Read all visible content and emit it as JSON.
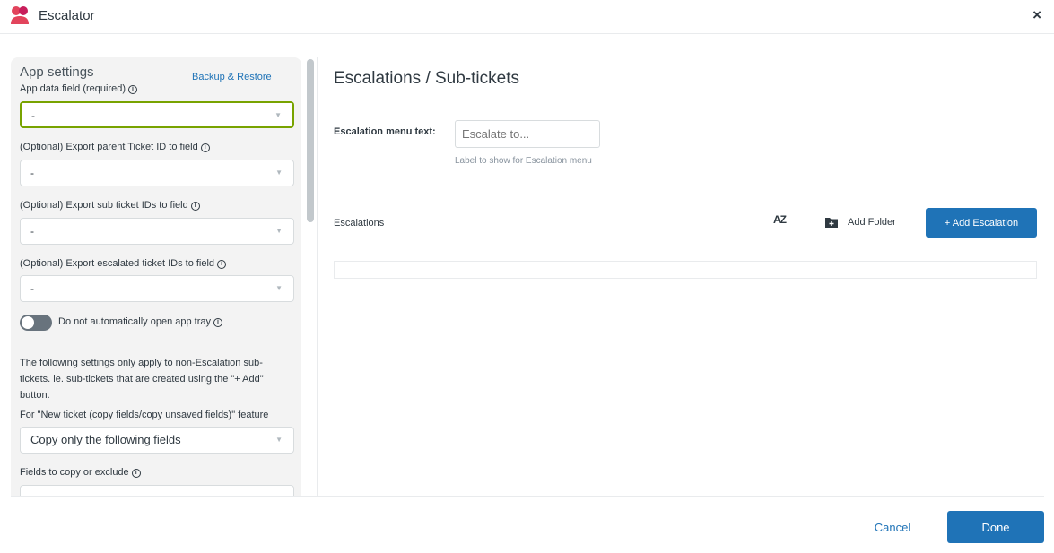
{
  "window": {
    "title": "Escalator",
    "close_label": "×"
  },
  "app_settings": {
    "heading": "App settings",
    "backup_link": "Backup & Restore",
    "app_data_field": {
      "label": "App data field (required)",
      "value": "-"
    },
    "export_parent": {
      "label": "(Optional) Export parent Ticket ID to field",
      "value": "-"
    },
    "export_sub": {
      "label": "(Optional) Export sub ticket IDs to field",
      "value": "-"
    },
    "export_escalated": {
      "label": "(Optional) Export escalated ticket IDs to field",
      "value": "-"
    },
    "toggle": {
      "label": "Do not automatically open app tray",
      "on": false
    },
    "note": "The following settings only apply to non-Escalation sub-tickets. ie. sub-tickets that are created using the \"+ Add\" button.",
    "new_ticket": {
      "label": "For \"New ticket (copy fields/copy unsaved fields)\" feature",
      "value": "Copy only the following fields"
    },
    "fields_to_copy": {
      "label": "Fields to copy or exclude",
      "value": ""
    }
  },
  "main": {
    "title": "Escalations / Sub-tickets",
    "menu_text": {
      "label": "Escalation menu text:",
      "placeholder": "Escalate to...",
      "hint": "Label to show for Escalation menu"
    },
    "escalations_label": "Escalations",
    "sort_icon_text": "AZ",
    "add_folder_label": "Add Folder",
    "add_escalation_label": "+ Add Escalation"
  },
  "footer": {
    "cancel_label": "Cancel",
    "done_label": "Done"
  },
  "colors": {
    "primary": "#1f73b7",
    "active_border": "#78a300",
    "logo_red": "#e2445c"
  },
  "icons": {
    "logo": "escalator-logo-icon",
    "sort": "sort-az-icon",
    "folder": "folder-plus-icon",
    "info": "info-icon",
    "chevron": "chevron-down-icon"
  }
}
